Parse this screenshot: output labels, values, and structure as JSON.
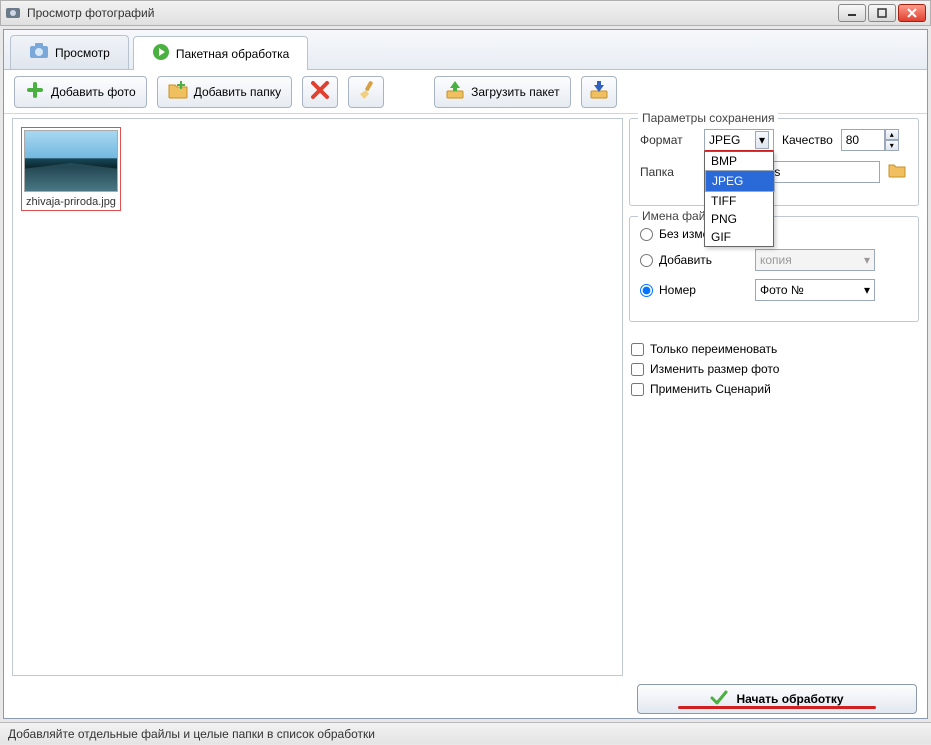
{
  "window": {
    "title": "Просмотр фотографий"
  },
  "tabs": {
    "preview": "Просмотр",
    "batch": "Пакетная обработка"
  },
  "toolbar": {
    "add_photo": "Добавить фото",
    "add_folder": "Добавить папку",
    "load_batch": "Загрузить пакет"
  },
  "thumb": {
    "caption": "zhivaja-priroda.jpg"
  },
  "params": {
    "legend": "Параметры сохранения",
    "format_label": "Формат",
    "format_value": "JPEG",
    "format_options": [
      "BMP",
      "JPEG",
      "TIFF",
      "PNG",
      "GIF"
    ],
    "quality_label": "Качество",
    "quality_value": "80",
    "folder_label": "Папка",
    "folder_value": "ublic\\Pictures"
  },
  "filenames": {
    "legend": "Имена фай",
    "nochange": "Без изменения",
    "add": "Добавить",
    "add_suffix": "копия",
    "number": "Номер",
    "number_prefix": "Фото №"
  },
  "checks": {
    "rename_only": "Только переименовать",
    "resize": "Изменить размер фото",
    "scenario": "Применить Сценарий"
  },
  "start_button": "Начать обработку",
  "status": "Добавляйте отдельные файлы и целые папки в список обработки"
}
